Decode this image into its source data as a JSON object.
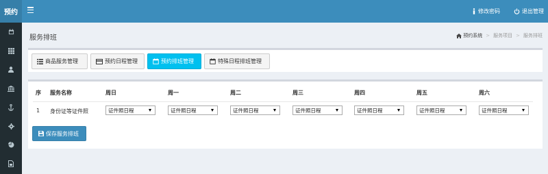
{
  "app": {
    "logo": "预约"
  },
  "header": {
    "menu_icon": "bars-icon",
    "change_password": "修改密码",
    "logout": "退出管理"
  },
  "sidebar": {
    "items": [
      {
        "icon": "calendar-icon"
      },
      {
        "icon": "grid-icon"
      },
      {
        "icon": "user-icon"
      },
      {
        "icon": "bank-icon"
      },
      {
        "icon": "anchor-icon"
      },
      {
        "icon": "gear-icon"
      },
      {
        "icon": "pie-chart-icon"
      },
      {
        "icon": "file-icon"
      }
    ]
  },
  "page": {
    "title": "服务排班",
    "breadcrumb": [
      "预约系统",
      "服务项目",
      "服务排班"
    ]
  },
  "tabs": [
    {
      "label": "商品服务管理",
      "icon": "list-icon",
      "active": false
    },
    {
      "label": "预约日程管理",
      "icon": "card-icon",
      "active": false
    },
    {
      "label": "预约排班管理",
      "icon": "calendar-icon",
      "active": true
    },
    {
      "label": "特殊日程排班管理",
      "icon": "calendar-icon",
      "active": false
    }
  ],
  "table": {
    "headers": [
      "序",
      "服务名称",
      "周日",
      "周一",
      "周二",
      "周三",
      "周四",
      "周五",
      "周六"
    ],
    "rows": [
      {
        "index": "1",
        "name": "身份证等证件照",
        "schedule": [
          "证件照日程",
          "证件照日程",
          "证件照日程",
          "证件照日程",
          "证件照日程",
          "证件照日程",
          "证件照日程"
        ]
      }
    ]
  },
  "save_button": "保存服务排班",
  "colors": {
    "header": "#3c8dbc",
    "logo": "#367fa9",
    "sidebar": "#222d32",
    "active_tab": "#00c0ef",
    "background": "#ecf0f5"
  }
}
